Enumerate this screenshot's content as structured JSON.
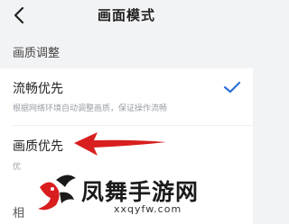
{
  "header": {
    "title": "画面模式",
    "back_icon": "chevron-left-icon"
  },
  "section": {
    "title": "画质调整"
  },
  "options": [
    {
      "label": "流畅优先",
      "description": "根据网络环境自动调整画质，保证操作流畅",
      "selected": true
    },
    {
      "label": "画质优先",
      "description": "优",
      "selected": false
    }
  ],
  "partial_label": "相",
  "watermark": {
    "name": "凤舞手游网",
    "url": "xxqyfw.com"
  },
  "colors": {
    "accent": "#2f6fd6",
    "arrow": "#d81e1e",
    "background": "#f2f3f5"
  }
}
